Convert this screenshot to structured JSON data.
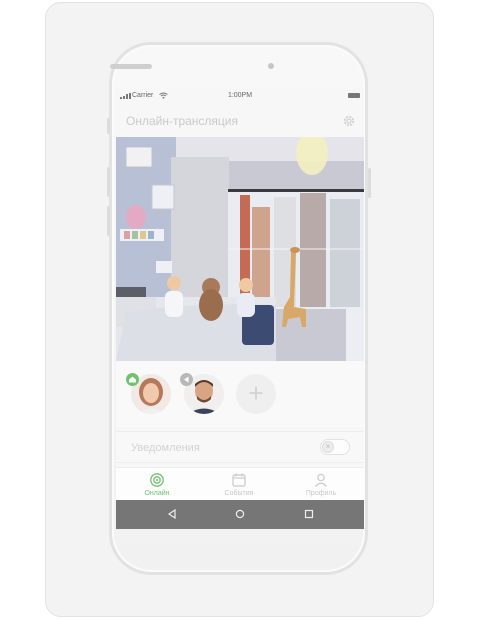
{
  "status_bar": {
    "carrier": "Carrier",
    "time": "1:00PM"
  },
  "app_bar": {
    "title": "Онлайн-трансляция",
    "settings_icon": "gear-icon"
  },
  "contacts": [
    {
      "name": "woman-avatar",
      "badge_icon": "home-icon",
      "badge_color": "#6fc36f"
    },
    {
      "name": "man-avatar",
      "badge_icon": "arrow-icon",
      "badge_color": "#b8b8b8"
    }
  ],
  "add_contact": {
    "label": "+"
  },
  "notifications": {
    "label": "Уведомления",
    "enabled": false
  },
  "tabs": [
    {
      "label": "Онлайн",
      "icon": "camera-icon",
      "active": true
    },
    {
      "label": "События",
      "icon": "calendar-icon",
      "active": false
    },
    {
      "label": "Профиль",
      "icon": "person-icon",
      "active": false
    }
  ],
  "colors": {
    "accent": "#6fc36f",
    "navbar": "#767676",
    "card": "#f3f3f3"
  }
}
